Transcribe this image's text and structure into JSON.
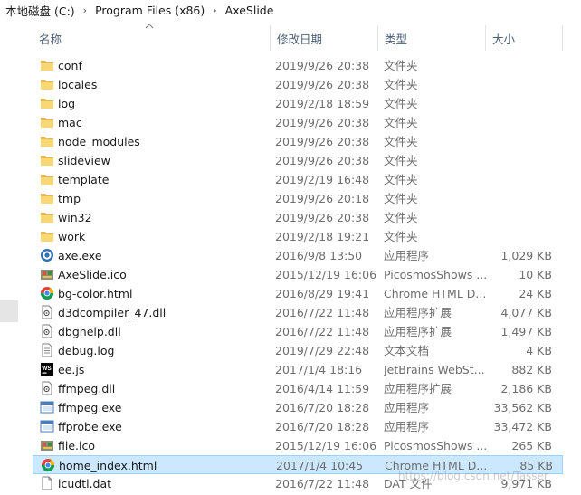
{
  "breadcrumb": [
    "本地磁盘 (C:)",
    "Program Files (x86)",
    "AxeSlide"
  ],
  "columns": {
    "name": "名称",
    "date": "修改日期",
    "type": "类型",
    "size": "大小"
  },
  "files": [
    {
      "name": "conf",
      "date": "2019/9/26 20:38",
      "type": "文件夹",
      "size": "",
      "icon": "folder-icon"
    },
    {
      "name": "locales",
      "date": "2019/9/26 20:38",
      "type": "文件夹",
      "size": "",
      "icon": "folder-icon"
    },
    {
      "name": "log",
      "date": "2019/2/18 18:59",
      "type": "文件夹",
      "size": "",
      "icon": "folder-icon"
    },
    {
      "name": "mac",
      "date": "2019/9/26 20:38",
      "type": "文件夹",
      "size": "",
      "icon": "folder-icon"
    },
    {
      "name": "node_modules",
      "date": "2019/9/26 20:38",
      "type": "文件夹",
      "size": "",
      "icon": "folder-icon"
    },
    {
      "name": "slideview",
      "date": "2019/9/26 20:38",
      "type": "文件夹",
      "size": "",
      "icon": "folder-icon"
    },
    {
      "name": "template",
      "date": "2019/2/19 16:48",
      "type": "文件夹",
      "size": "",
      "icon": "folder-icon"
    },
    {
      "name": "tmp",
      "date": "2019/9/26 20:18",
      "type": "文件夹",
      "size": "",
      "icon": "folder-icon"
    },
    {
      "name": "win32",
      "date": "2019/9/26 20:38",
      "type": "文件夹",
      "size": "",
      "icon": "folder-icon"
    },
    {
      "name": "work",
      "date": "2019/2/18 19:21",
      "type": "文件夹",
      "size": "",
      "icon": "folder-icon"
    },
    {
      "name": "axe.exe",
      "date": "2016/9/8 13:50",
      "type": "应用程序",
      "size": "1,029 KB",
      "icon": "axe-app-icon"
    },
    {
      "name": "AxeSlide.ico",
      "date": "2015/12/19 16:06",
      "type": "PicosmosShows ...",
      "size": "10 KB",
      "icon": "image-file-icon"
    },
    {
      "name": "bg-color.html",
      "date": "2016/8/29 19:41",
      "type": "Chrome HTML D...",
      "size": "24 KB",
      "icon": "chrome-icon"
    },
    {
      "name": "d3dcompiler_47.dll",
      "date": "2016/7/22 11:48",
      "type": "应用程序扩展",
      "size": "4,077 KB",
      "icon": "dll-file-icon"
    },
    {
      "name": "dbghelp.dll",
      "date": "2016/7/22 11:48",
      "type": "应用程序扩展",
      "size": "1,497 KB",
      "icon": "dll-file-icon"
    },
    {
      "name": "debug.log",
      "date": "2019/7/29 22:48",
      "type": "文本文档",
      "size": "4 KB",
      "icon": "text-file-icon"
    },
    {
      "name": "ee.js",
      "date": "2017/1/4 18:16",
      "type": "JetBrains WebSt...",
      "size": "882 KB",
      "icon": "webstorm-icon"
    },
    {
      "name": "ffmpeg.dll",
      "date": "2016/4/14 11:59",
      "type": "应用程序扩展",
      "size": "2,186 KB",
      "icon": "dll-file-icon"
    },
    {
      "name": "ffmpeg.exe",
      "date": "2016/7/20 18:28",
      "type": "应用程序",
      "size": "33,562 KB",
      "icon": "exe-window-icon"
    },
    {
      "name": "ffprobe.exe",
      "date": "2016/7/20 18:28",
      "type": "应用程序",
      "size": "33,472 KB",
      "icon": "exe-window-icon"
    },
    {
      "name": "file.ico",
      "date": "2015/12/19 16:06",
      "type": "PicosmosShows ...",
      "size": "265 KB",
      "icon": "image-file-icon"
    },
    {
      "name": "home_index.html",
      "date": "2017/1/4 10:45",
      "type": "Chrome HTML D...",
      "size": "85 KB",
      "icon": "chrome-icon",
      "selected": true
    },
    {
      "name": "icudtl.dat",
      "date": "2016/7/22 11:48",
      "type": "DAT 文件",
      "size": "9,971 KB",
      "icon": "blank-file-icon"
    }
  ],
  "watermark": "https://blog.csdn.net/Tasser"
}
